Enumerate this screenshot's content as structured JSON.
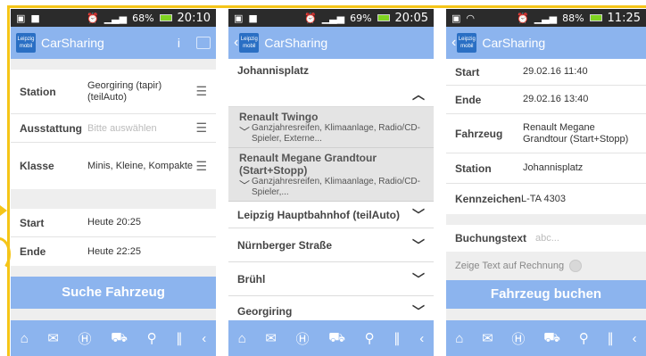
{
  "phone1": {
    "status": {
      "battery": "68%",
      "time": "20:10"
    },
    "appbar": {
      "title": "CarSharing",
      "info": "i"
    },
    "logo_text": "Leipzig mobil",
    "fields": [
      {
        "label": "Station",
        "value": "Georgiring (tapir) (teilAuto)"
      },
      {
        "label": "Ausstattung",
        "placeholder": "Bitte auswählen"
      },
      {
        "label": "Klasse",
        "value": "Minis, Kleine, Kompakte"
      }
    ],
    "times": [
      {
        "label": "Start",
        "value": "Heute 20:25"
      },
      {
        "label": "Ende",
        "value": "Heute 22:25"
      }
    ],
    "search_button": "Suche Fahrzeug"
  },
  "phone2": {
    "status": {
      "battery": "69%",
      "time": "20:05"
    },
    "appbar": {
      "title": "CarSharing"
    },
    "stations": [
      {
        "name": "Johannisplatz",
        "expanded": true
      },
      {
        "name": "Leipzig Hauptbahnhof (teilAuto)"
      },
      {
        "name": "Nürnberger Straße"
      },
      {
        "name": "Brühl"
      },
      {
        "name": "Georgiring"
      }
    ],
    "cars": [
      {
        "name": "Renault Twingo",
        "features": "Ganzjahresreifen, Klimaanlage, Radio/CD-Spieler, Externe..."
      },
      {
        "name": "Renault Megane Grandtour (Start+Stopp)",
        "features": "Ganzjahresreifen, Klimaanlage, Radio/CD-Spieler,..."
      }
    ]
  },
  "phone3": {
    "status": {
      "battery": "88%",
      "time": "11:25"
    },
    "appbar": {
      "title": "CarSharing"
    },
    "details": [
      {
        "label": "Start",
        "value": "29.02.16 11:40"
      },
      {
        "label": "Ende",
        "value": "29.02.16 13:40"
      },
      {
        "label": "Fahrzeug",
        "value": "Renault Megane Grandtour (Start+Stopp)"
      },
      {
        "label": "Station",
        "value": "Johannisplatz"
      },
      {
        "label": "Kennzeichen",
        "value": "L-TA 4303"
      }
    ],
    "buchungstext": {
      "label": "Buchungstext",
      "placeholder": "abc..."
    },
    "show_on_invoice": "Zeige Text auf Rechnung",
    "book_button": "Fahrzeug buchen"
  },
  "colors": {
    "accent": "#8cb4ee",
    "frame": "#f5c518",
    "status_bar": "#2b2b2b"
  },
  "nav_icons": [
    "home-icon",
    "map-icon",
    "bus-stop-icon",
    "car-icon",
    "bike-icon",
    "route-icon",
    "collapse-icon"
  ]
}
